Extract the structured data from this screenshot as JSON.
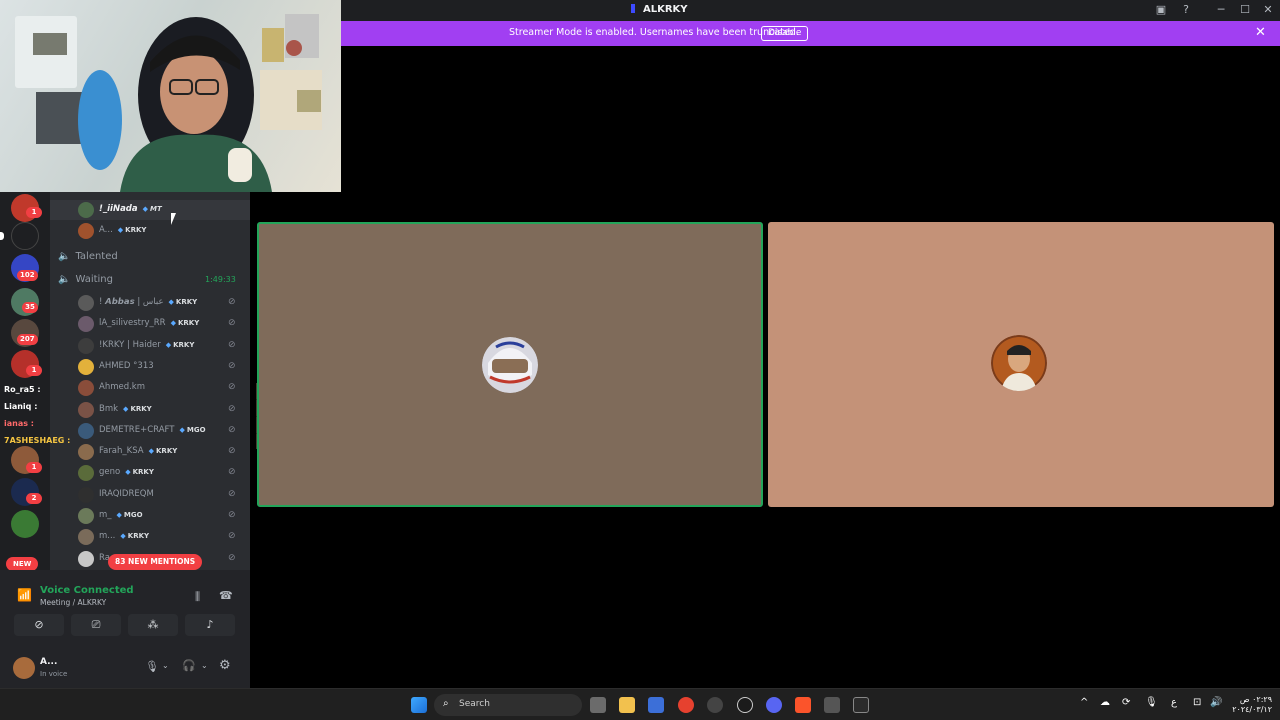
{
  "window": {
    "title": "ALKRKY"
  },
  "banner": {
    "message": "Streamer Mode is enabled. Usernames have been truncated.",
    "disable_label": "Disable"
  },
  "rail": {
    "badges": [
      "1",
      "102",
      "35",
      "207",
      "1",
      "1",
      "2"
    ],
    "new_label": "NEW"
  },
  "channels": {
    "top_members": [
      {
        "name": "!_iiNada",
        "tag": "MT"
      },
      {
        "name": "A...",
        "tag": "KRKY"
      }
    ],
    "talented": "Talented",
    "waiting": {
      "name": "Waiting",
      "timer": "1:49:33"
    },
    "members": [
      {
        "name": "! 𝘼𝙗𝙗𝙖𝙨 | عباس",
        "tag": "KRKY"
      },
      {
        "name": "lA_silivestry_RR",
        "tag": "KRKY"
      },
      {
        "name": "!KRKY | Haider",
        "tag": "KRKY"
      },
      {
        "name": "AHMED °313",
        "tag": ""
      },
      {
        "name": "Ahmed.km",
        "tag": ""
      },
      {
        "name": "Bmk",
        "tag": "KRKY"
      },
      {
        "name": "DEMETRE+CRAFT",
        "tag": "MGO"
      },
      {
        "name": "Farah_KSA",
        "tag": "KRKY"
      },
      {
        "name": "geno",
        "tag": "KRKY"
      },
      {
        "name": "IRAQIDREQM",
        "tag": ""
      },
      {
        "name": "m_",
        "tag": "MGO"
      },
      {
        "name": "m...",
        "tag": "KRKY"
      },
      {
        "name": "Ra",
        "tag": ""
      }
    ],
    "overlay_names": [
      "Ro_ra5 :",
      "Lianiq :",
      "ianas :",
      "7ASHESHAEG :"
    ],
    "mentions": "83 NEW MENTIONS"
  },
  "voice": {
    "status": "Voice Connected",
    "location": "Meeting / ALKRKY",
    "user_name": "A...",
    "user_status": "In voice"
  },
  "taskbar": {
    "search_label": "Search",
    "clock_time": "٠٢:٢٩ ص",
    "clock_date": "٢٠٢٤/٠٣/١٢",
    "lang": "ع"
  },
  "colors": {
    "accent": "#a13ff2",
    "speaking": "#23a55a",
    "danger": "#f23f43"
  }
}
